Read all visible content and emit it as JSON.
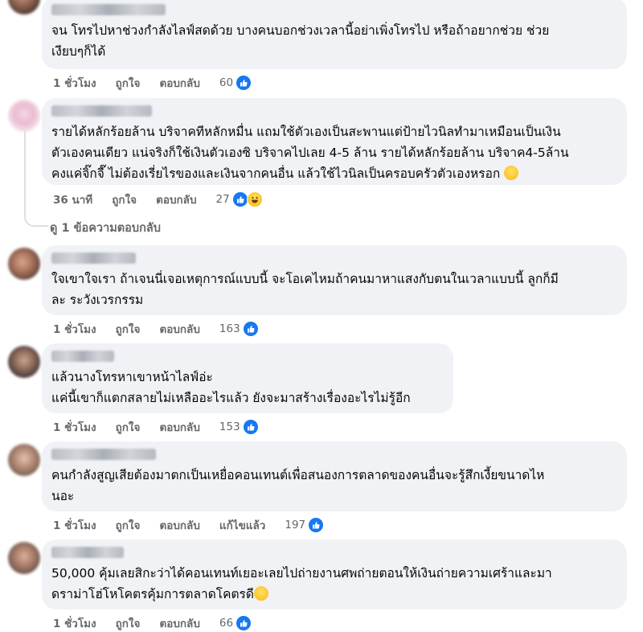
{
  "comments": [
    {
      "text": "จน โทรไปหาช่วงกำลังไลฟ์สดด้วย บางคนบอกช่วงเวลานี้อย่าเพิ่งโทรไป หรือถ้าอยากช่วย ช่วย\nเงียบๆก็ได้",
      "time": "1 ชั่วโมง",
      "like_label": "ถูกใจ",
      "reply_label": "ตอบกลับ",
      "reaction_count": "60"
    },
    {
      "text": "รายได้หลักร้อยล้าน บริจาคทีหลักหมื่น แถมใช้ตัวเองเป็นสะพานแต่ป้ายไวนิลทำมาเหมือนเป็นเงิน\nตัวเองคนเดียว แน่จริงก็ใช้เงินตัวเองซิ บริจาคไปเลย 4-5 ล้าน รายได้หลักร้อยล้าน บริจาค4-5ล้าน\nคงแค่จิ๊กจี๊ ไม่ต้องเรี่ยไรของและเงินจากคนอื่น แล้วใช้ไวนิลเป็นครอบครัวตัวเองหรอก",
      "emoji": "rofl-emoji",
      "time": "36 นาที",
      "like_label": "ถูกใจ",
      "reply_label": "ตอบกลับ",
      "reaction_count": "27"
    },
    {
      "text": "ใจเขาใจเรา ถ้าเจนนี่เจอเหตุการณ์แบบนี้ จะโอเคไหมถ้าคนมาหาแสงกับตนในเวลาแบบนี้ ลูกก็มี\nละ ระวังเวรกรรม",
      "time": "1 ชั่วโมง",
      "like_label": "ถูกใจ",
      "reply_label": "ตอบกลับ",
      "reaction_count": "163"
    },
    {
      "text": "แล้วนางโทรหาเขาหน้าไลฟ์อ่ะ\nแค่นี้เขาก็แตกสลายไม่เหลืออะไรแล้ว ยังจะมาสร้างเรื่องอะไรไม่รู้อีก",
      "time": "1 ชั่วโมง",
      "like_label": "ถูกใจ",
      "reply_label": "ตอบกลับ",
      "reaction_count": "153"
    },
    {
      "text": "คนกำลังสูญเสียต้องมาตกเป็นเหยื่อคอนเทนต์เพื่อสนองการตลาดของคนอื่นจะรู้สึกเงี้ยขนาดไห\nนอะ",
      "time": "1 ชั่วโมง",
      "like_label": "ถูกใจ",
      "reply_label": "ตอบกลับ",
      "edited_label": "แก้ไขแล้ว",
      "reaction_count": "197"
    },
    {
      "text": "50,000 คุ้มเลยสิกะว่าได้คอนเทนท์เยอะเลยไปถ่ายงานศพถ่ายตอนให้เงินถ่ายความเศร้าและมา\nดราม่าโฮ่โหโคตรคุ้มการตลาดโคตรดี",
      "emoji": "relieved-emoji",
      "time": "1 ชั่วโมง",
      "like_label": "ถูกใจ",
      "reply_label": "ตอบกลับ",
      "reaction_count": "66"
    }
  ],
  "view_replies_label": "ดู 1 ข้อความตอบกลับ",
  "colors": {
    "bubble": "#f0f2f5",
    "like": "#1877f2",
    "meta": "#65676b"
  }
}
